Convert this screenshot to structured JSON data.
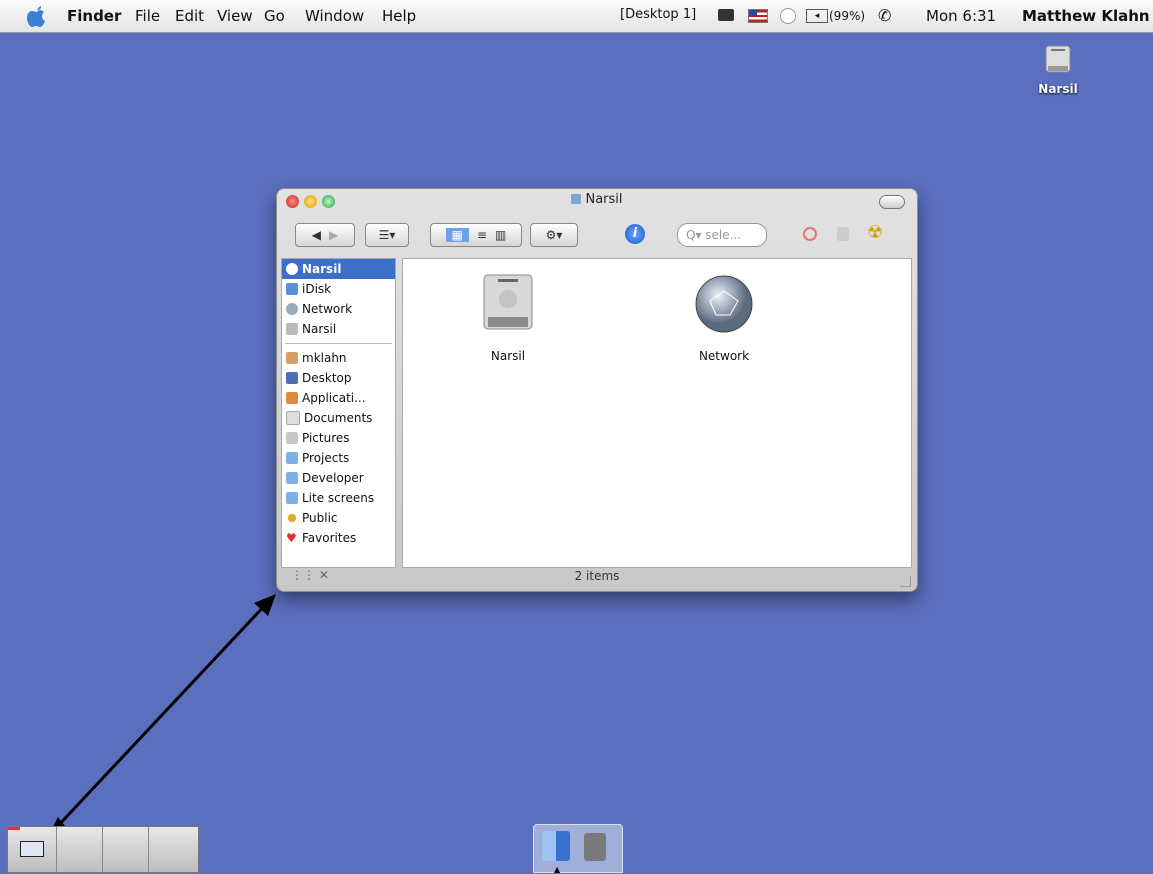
{
  "menubar": {
    "app": "Finder",
    "menus": [
      "File",
      "Edit",
      "View",
      "Go",
      "Window",
      "Help"
    ],
    "desktop": "[Desktop 1]",
    "battery": "(99%)",
    "clock": "Mon 6:31",
    "user": "Matthew Klahn"
  },
  "desktop": {
    "icon_label": "Narsil"
  },
  "window": {
    "title": "Narsil",
    "search_placeholder": "Q▾ sele...",
    "sidebar": {
      "volumes": [
        "Narsil",
        "iDisk",
        "Network",
        "Narsil"
      ],
      "places": [
        "mklahn",
        "Desktop",
        "Applicati...",
        "Documents",
        "Pictures",
        "Projects",
        "Developer",
        "Lite screens",
        "Public",
        "Favorites"
      ]
    },
    "items": [
      "Narsil",
      "Network"
    ],
    "status": "2 items"
  },
  "colors": {
    "desktop": "#5b6fbf",
    "selection": "#3d6ec9"
  }
}
